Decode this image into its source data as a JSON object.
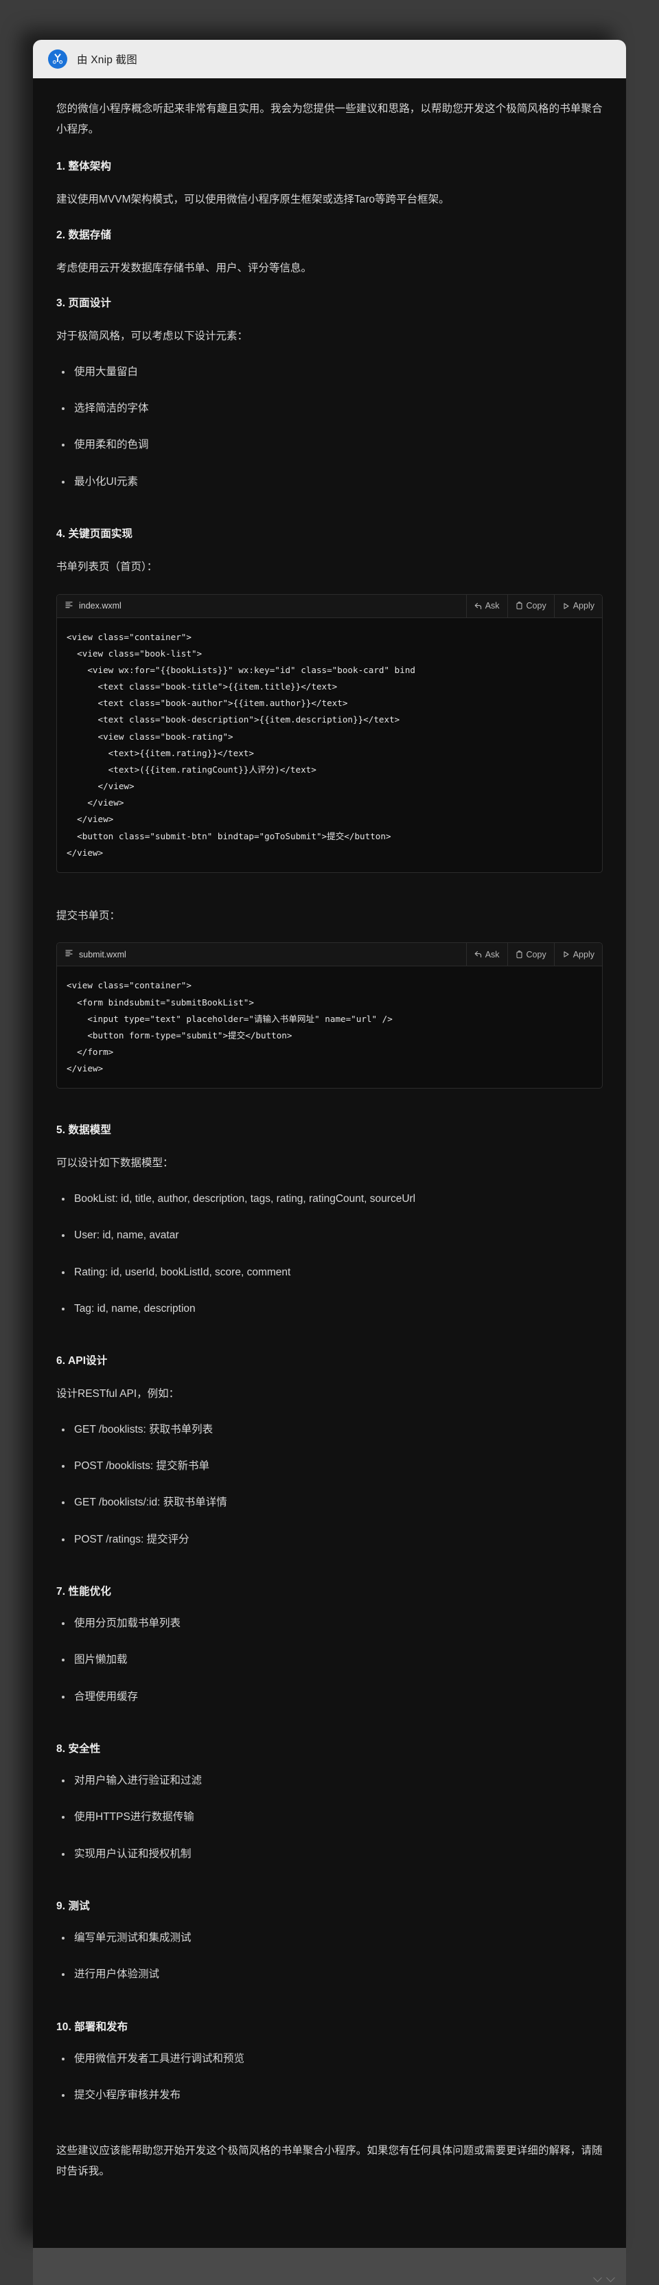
{
  "titlebar": {
    "label": "由 Xnip 截图",
    "logo_icon": "xnip-scissors-icon",
    "bg": "#ececec"
  },
  "theme": {
    "bg": "#111111",
    "text": "#d7d7d7",
    "code_bg": "#0d0d0d",
    "accent": "#1a72d8"
  },
  "message": {
    "intro": "您的微信小程序概念听起来非常有趣且实用。我会为您提供一些建议和思路，以帮助您开发这个极简风格的书单聚合小程序。",
    "sections": [
      {
        "heading": "1. 整体架构",
        "body": "建议使用MVVM架构模式，可以使用微信小程序原生框架或选择Taro等跨平台框架。"
      },
      {
        "heading": "2. 数据存储",
        "body": "考虑使用云开发数据库存储书单、用户、评分等信息。"
      },
      {
        "heading": "3. 页面设计",
        "body": "对于极简风格，可以考虑以下设计元素：",
        "bullets": [
          "使用大量留白",
          "选择简洁的字体",
          "使用柔和的色调",
          "最小化UI元素"
        ]
      },
      {
        "heading": "4. 关键页面实现"
      }
    ],
    "code_label_1": "书单列表页（首页）：",
    "code_label_2": "提交书单页：",
    "section_5": {
      "heading": "5. 数据模型",
      "body": "可以设计如下数据模型：",
      "bullets": [
        "BookList: id, title, author, description, tags, rating, ratingCount, sourceUrl",
        "User: id, name, avatar",
        "Rating: id, userId, bookListId, score, comment",
        "Tag: id, name, description"
      ]
    },
    "section_6": {
      "heading": "6. API设计",
      "body": "设计RESTful API，例如：",
      "bullets": [
        "GET /booklists: 获取书单列表",
        "POST /booklists: 提交新书单",
        "GET /booklists/:id: 获取书单详情",
        "POST /ratings: 提交评分"
      ]
    },
    "section_7": {
      "heading": "7. 性能优化",
      "bullets": [
        "使用分页加载书单列表",
        "图片懒加载",
        "合理使用缓存"
      ]
    },
    "section_8": {
      "heading": "8. 安全性",
      "bullets": [
        "对用户输入进行验证和过滤",
        "使用HTTPS进行数据传输",
        "实现用户认证和授权机制"
      ]
    },
    "section_9": {
      "heading": "9. 测试",
      "bullets": [
        "编写单元测试和集成测试",
        "进行用户体验测试"
      ]
    },
    "section_10": {
      "heading": "10. 部署和发布",
      "bullets": [
        "使用微信开发者工具进行调试和预览",
        "提交小程序审核并发布"
      ]
    },
    "outro": "这些建议应该能帮助您开始开发这个极简风格的书单聚合小程序。如果您有任何具体问题或需要更详细的解释，请随时告诉我。"
  },
  "code_blocks": [
    {
      "filename": "index.wxml",
      "file_icon": "code-lines-icon",
      "actions": [
        {
          "label": "Ask",
          "icon": "arrow-reply-icon"
        },
        {
          "label": "Copy",
          "icon": "clipboard-icon"
        },
        {
          "label": "Apply",
          "icon": "play-triangle-icon"
        }
      ],
      "code": "<view class=\"container\">\n  <view class=\"book-list\">\n    <view wx:for=\"{{bookLists}}\" wx:key=\"id\" class=\"book-card\" bind\n      <text class=\"book-title\">{{item.title}}</text>\n      <text class=\"book-author\">{{item.author}}</text>\n      <text class=\"book-description\">{{item.description}}</text>\n      <view class=\"book-rating\">\n        <text>{{item.rating}}</text>\n        <text>({{item.ratingCount}}人评分)</text>\n      </view>\n    </view>\n  </view>\n  <button class=\"submit-btn\" bindtap=\"goToSubmit\">提交</button>\n</view>"
    },
    {
      "filename": "submit.wxml",
      "file_icon": "code-lines-icon",
      "actions": [
        {
          "label": "Ask",
          "icon": "arrow-reply-icon"
        },
        {
          "label": "Copy",
          "icon": "clipboard-icon"
        },
        {
          "label": "Apply",
          "icon": "play-triangle-icon"
        }
      ],
      "code": "<view class=\"container\">\n  <form bindsubmit=\"submitBookList\">\n    <input type=\"text\" placeholder=\"请输入书单网址\" name=\"url\" />\n    <button form-type=\"submit\">提交</button>\n  </form>\n</view>"
    }
  ]
}
